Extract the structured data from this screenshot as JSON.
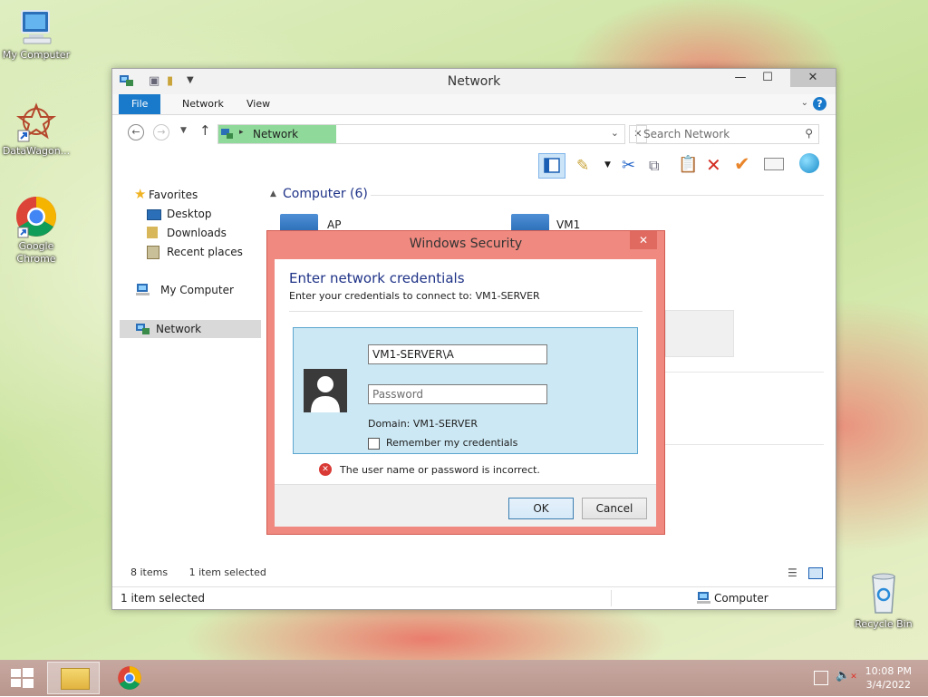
{
  "desktop": {
    "icons": [
      {
        "label": "My Computer"
      },
      {
        "label": "DataWagon..."
      },
      {
        "label": "Google Chrome"
      },
      {
        "label": "Recycle Bin"
      }
    ]
  },
  "explorer": {
    "title": "Network",
    "ribbon_tabs": [
      "File",
      "Network",
      "View"
    ],
    "address_path": "Network",
    "search_placeholder": "Search Network",
    "nav": {
      "favorites": "Favorites",
      "desktop": "Desktop",
      "downloads": "Downloads",
      "recent": "Recent places",
      "my_computer": "My Computer",
      "network": "Network"
    },
    "group_header": "Computer (6)",
    "items": [
      "AP",
      "VM1"
    ],
    "item_count": "8 items",
    "selection": "1 item selected",
    "status_selection": "1 item selected",
    "status_location": "Computer"
  },
  "dialog": {
    "title": "Windows Security",
    "heading": "Enter network credentials",
    "subheading": "Enter your credentials to connect to: VM1-SERVER",
    "username_value": "VM1-SERVER\\A",
    "password_placeholder": "Password",
    "domain_text": "Domain: VM1-SERVER",
    "remember_label": "Remember my credentials",
    "error_text": "The user name or password is incorrect.",
    "ok_label": "OK",
    "cancel_label": "Cancel"
  },
  "taskbar": {
    "time": "10:08 PM",
    "date": "3/4/2022"
  },
  "colors": {
    "accent": "#1979ca",
    "dialog_border": "#f08a80",
    "credential_panel": "#cce8f4",
    "address_highlight": "#8fd99a"
  }
}
